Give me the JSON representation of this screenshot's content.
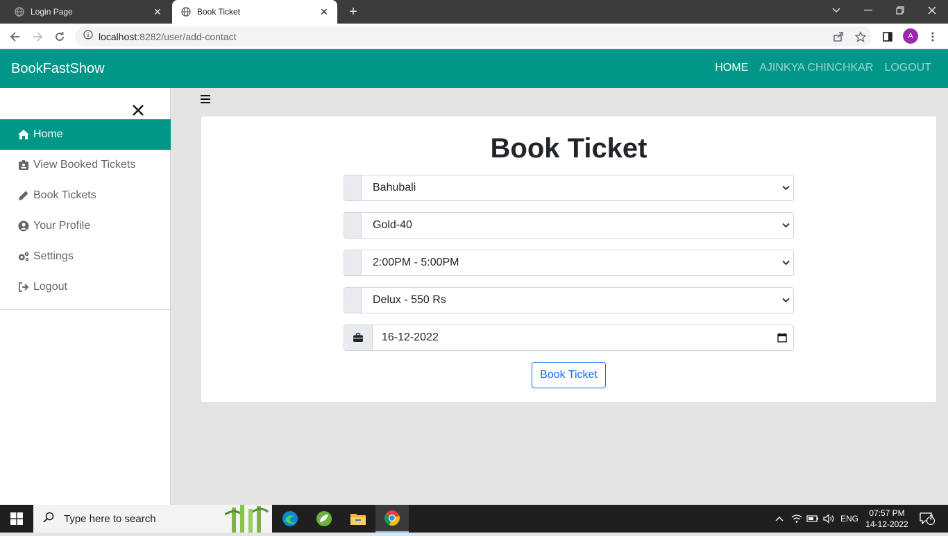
{
  "browser": {
    "tabs": [
      {
        "title": "Login Page",
        "active": false
      },
      {
        "title": "Book Ticket",
        "active": true
      }
    ],
    "url_host": "localhost",
    "url_rest": ":8282/user/add-contact",
    "profile_initial": "A"
  },
  "navbar": {
    "brand": "BookFastShow",
    "links": [
      "HOME",
      "AJINKYA CHINCHKAR",
      "LOGOUT"
    ]
  },
  "sidebar": {
    "items": [
      {
        "label": "Home",
        "icon": "home-icon"
      },
      {
        "label": "View Booked Tickets",
        "icon": "id-badge-icon"
      },
      {
        "label": "Book Tickets",
        "icon": "pencil-icon"
      },
      {
        "label": "Your Profile",
        "icon": "user-circle-icon"
      },
      {
        "label": "Settings",
        "icon": "cogs-icon"
      },
      {
        "label": "Logout",
        "icon": "sign-out-icon"
      }
    ]
  },
  "form": {
    "title": "Book Ticket",
    "movie": "Bahubali",
    "theatre": "Gold-40",
    "timing": "2:00PM - 5:00PM",
    "seat_class": "Delux - 550 Rs",
    "date": "16-12-2022",
    "submit_label": "Book Ticket"
  },
  "taskbar": {
    "search_placeholder": "Type here to search",
    "language": "ENG",
    "time": "07:57 PM",
    "date": "14-12-2022",
    "notification_count": "2"
  },
  "colors": {
    "accent": "#009688",
    "primary_button": "#0d6efd"
  }
}
